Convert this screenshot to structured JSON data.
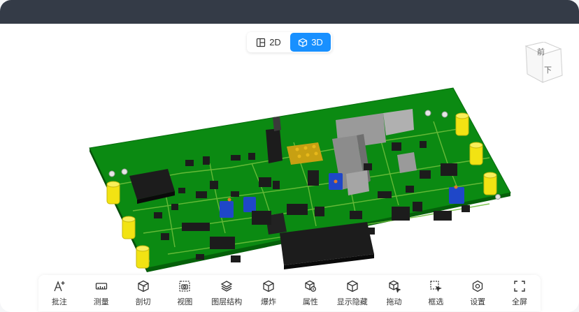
{
  "view_toggle": {
    "label_2d": "2D",
    "label_3d": "3D",
    "active": "3D",
    "active_color": "#1890ff"
  },
  "view_cube": {
    "face_top": "前",
    "face_side": "下"
  },
  "toolbar": {
    "items": [
      {
        "label": "批注",
        "icon": "annotate-icon"
      },
      {
        "label": "测量",
        "icon": "ruler-icon"
      },
      {
        "label": "剖切",
        "icon": "section-cube-icon"
      },
      {
        "label": "视图",
        "icon": "camera-view-icon"
      },
      {
        "label": "图层结构",
        "icon": "layers-icon"
      },
      {
        "label": "爆炸",
        "icon": "explode-cube-icon"
      },
      {
        "label": "属性",
        "icon": "properties-icon"
      },
      {
        "label": "显示隐藏",
        "icon": "show-hide-icon"
      },
      {
        "label": "拖动",
        "icon": "drag-cube-icon"
      },
      {
        "label": "框选",
        "icon": "box-select-icon"
      },
      {
        "label": "设置",
        "icon": "gear-icon"
      },
      {
        "label": "全屏",
        "icon": "fullscreen-icon"
      }
    ]
  },
  "colors": {
    "titlebar": "#343b47",
    "pcb_green": "#0b8a12",
    "trace_green": "#6fbf3c",
    "connector_yellow": "#f2e313",
    "component_black": "#1c1c1c",
    "component_gray": "#9a9a9a",
    "potentiometer_blue": "#1f47c8"
  }
}
